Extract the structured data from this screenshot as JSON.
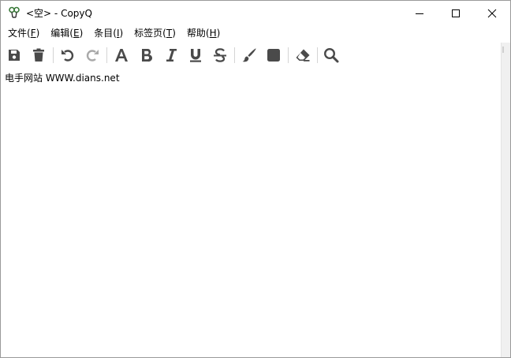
{
  "window": {
    "title": "<空> - CopyQ"
  },
  "menu": [
    {
      "label": "文件(",
      "mnemonic": "F",
      "suffix": ")"
    },
    {
      "label": "编辑(",
      "mnemonic": "E",
      "suffix": ")"
    },
    {
      "label": "条目(",
      "mnemonic": "I",
      "suffix": ")"
    },
    {
      "label": "标签页(",
      "mnemonic": "T",
      "suffix": ")"
    },
    {
      "label": "帮助(",
      "mnemonic": "H",
      "suffix": ")"
    }
  ],
  "toolbar": {
    "icons": [
      "save-icon",
      "trash-icon",
      "undo-icon",
      "redo-icon",
      "font-icon",
      "bold-icon",
      "italic-icon",
      "underline-icon",
      "strikethrough-icon",
      "brush-icon",
      "color-square-icon",
      "eraser-icon",
      "search-icon"
    ]
  },
  "editor": {
    "content": "电手网站 WWW.dians.net"
  },
  "colors": {
    "icon": "#4a4a4a",
    "icon_disabled": "#a9a9a9"
  }
}
